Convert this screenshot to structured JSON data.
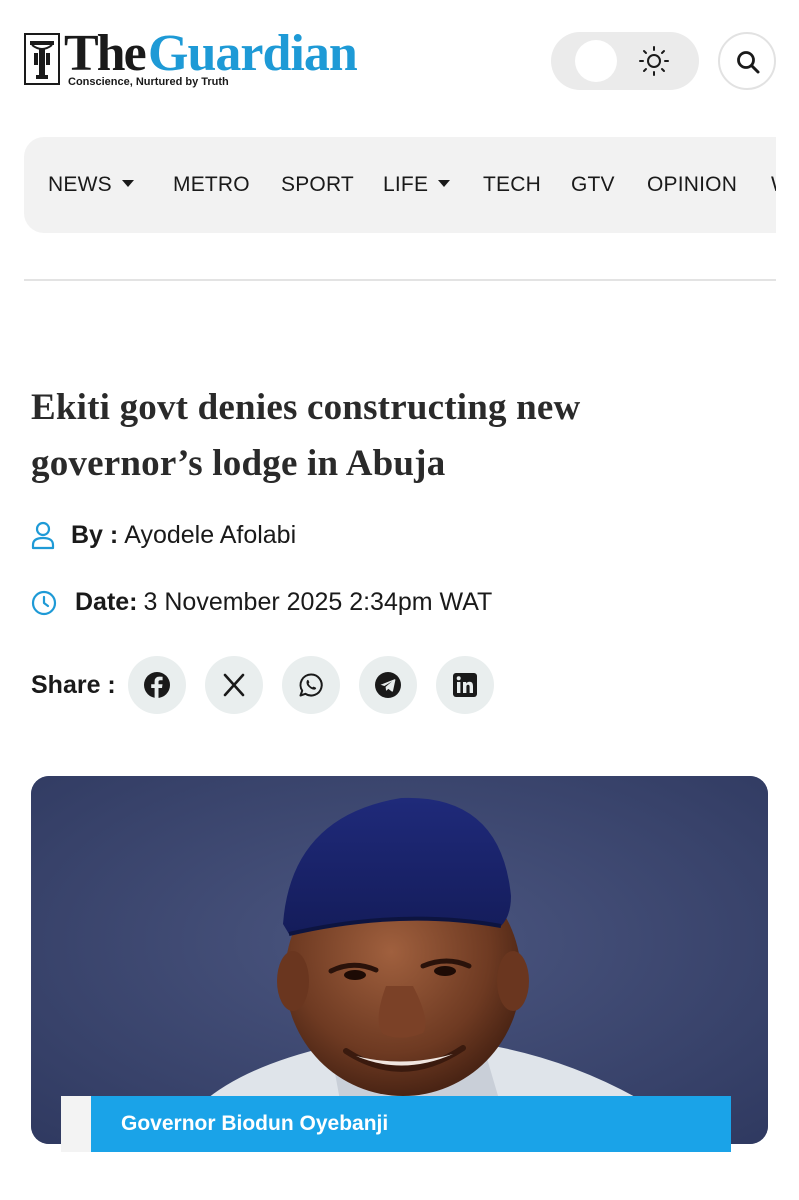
{
  "brand": {
    "name_part1": "The",
    "name_part2": "Guardian",
    "tagline": "Conscience, Nurtured by Truth",
    "accent_color": "#1e9ad6"
  },
  "header": {
    "theme_toggle_icon": "sun-icon",
    "search_icon": "search-icon"
  },
  "nav": {
    "items": [
      {
        "label": "NEWS",
        "has_dropdown": true
      },
      {
        "label": "METRO",
        "has_dropdown": false
      },
      {
        "label": "SPORT",
        "has_dropdown": false
      },
      {
        "label": "LIFE",
        "has_dropdown": true
      },
      {
        "label": "TECH",
        "has_dropdown": false
      },
      {
        "label": "GTV",
        "has_dropdown": false
      },
      {
        "label": "OPINION",
        "has_dropdown": false
      },
      {
        "label": "W",
        "has_dropdown": false
      }
    ]
  },
  "article": {
    "headline": "Ekiti govt denies constructing new governor’s lodge in Abuja",
    "author_label": "By :",
    "author": "Ayodele Afolabi",
    "date_label": "Date:",
    "date": "3 November 2025 2:34pm WAT",
    "share_label": "Share :",
    "share_icons": [
      "facebook-icon",
      "x-icon",
      "whatsapp-icon",
      "telegram-icon",
      "linkedin-icon"
    ],
    "image_caption": "Governor Biodun Oyebanji",
    "caption_color": "#1aa3e8"
  }
}
